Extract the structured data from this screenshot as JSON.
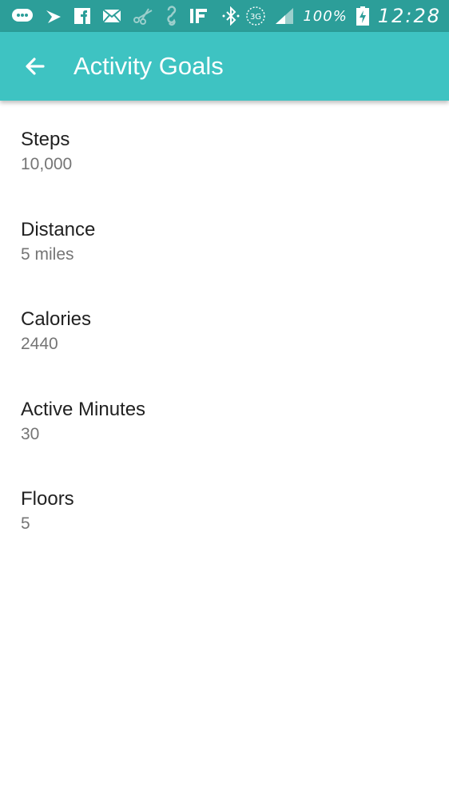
{
  "status_bar": {
    "battery_percent": "100%",
    "time": "12:28",
    "network": "3G",
    "icons": [
      "message-icon",
      "sprint-icon",
      "facebook-icon",
      "email-icon",
      "scissors-icon",
      "hook-icon",
      "ifttt-icon",
      "bluetooth-icon",
      "network-3g-icon",
      "signal-icon",
      "battery-charging-icon"
    ]
  },
  "app_bar": {
    "title": "Activity Goals",
    "back_icon": "arrow-back-icon",
    "color": "#3ec3c2"
  },
  "goals": [
    {
      "label": "Steps",
      "value": "10,000"
    },
    {
      "label": "Distance",
      "value": "5 miles"
    },
    {
      "label": "Calories",
      "value": "2440"
    },
    {
      "label": "Active Minutes",
      "value": "30"
    },
    {
      "label": "Floors",
      "value": "5"
    }
  ]
}
